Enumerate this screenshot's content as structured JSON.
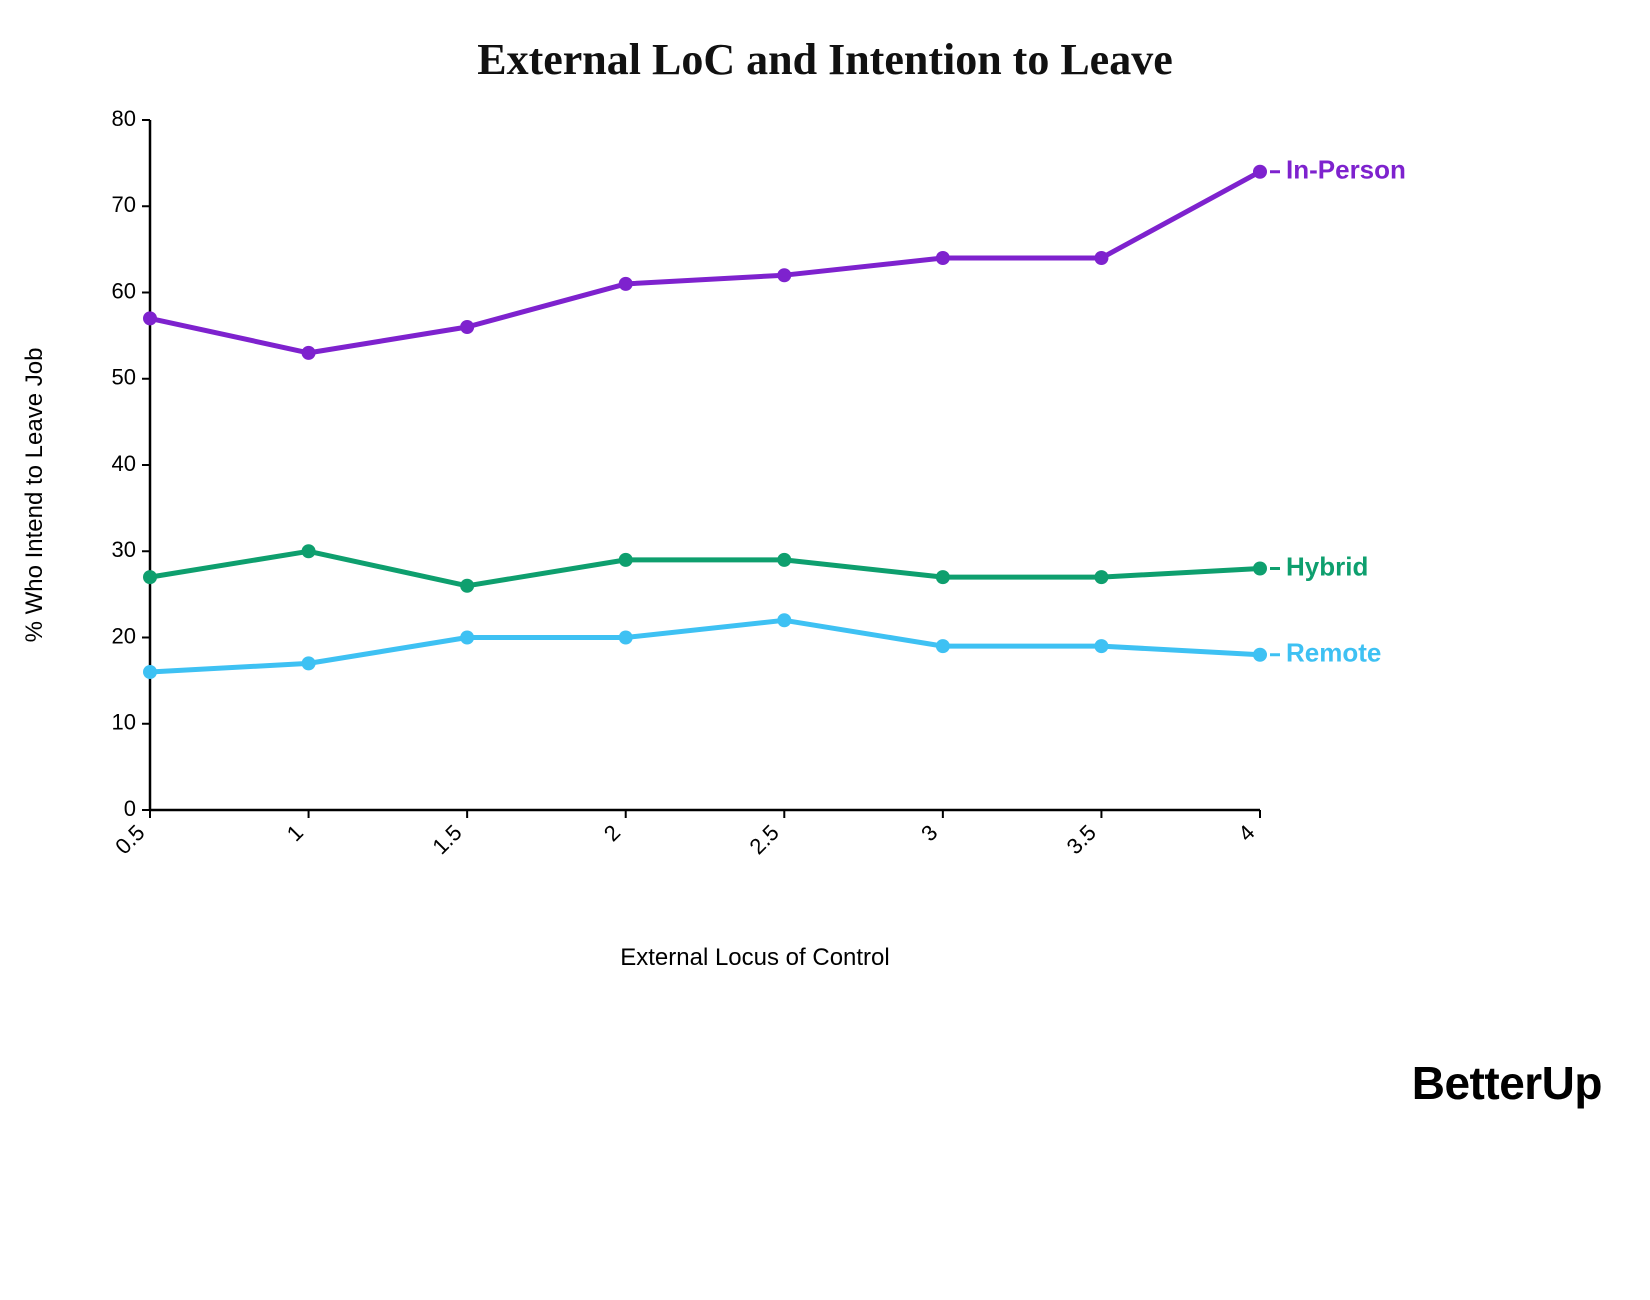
{
  "chart_data": {
    "type": "line",
    "title": "External LoC and Intention to Leave",
    "xlabel": "External Locus of Control",
    "ylabel": "% Who Intend to Leave Job",
    "x": [
      0.5,
      1,
      1.5,
      2,
      2.5,
      3,
      3.5,
      4
    ],
    "x_ticklabels": [
      "0.5",
      "1",
      "1.5",
      "2",
      "2.5",
      "3",
      "3.5",
      "4"
    ],
    "ylim": [
      0,
      80
    ],
    "y_ticks": [
      0,
      10,
      20,
      30,
      40,
      50,
      60,
      70,
      80
    ],
    "series": [
      {
        "name": "In-Person",
        "color": "#7E22CE",
        "values": [
          57,
          53,
          56,
          61,
          62,
          64,
          64,
          74
        ]
      },
      {
        "name": "Hybrid",
        "color": "#0E9F6E",
        "values": [
          27,
          30,
          26,
          29,
          29,
          27,
          27,
          28
        ]
      },
      {
        "name": "Remote",
        "color": "#3EC1F3",
        "values": [
          16,
          17,
          20,
          20,
          22,
          19,
          19,
          18
        ]
      }
    ],
    "legend_position": "right"
  },
  "brand": "BetterUp"
}
